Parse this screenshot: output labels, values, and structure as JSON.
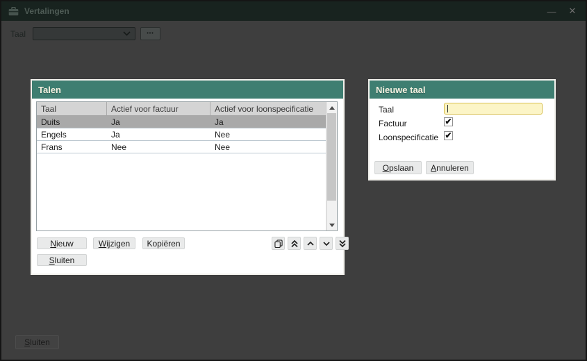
{
  "window": {
    "title": "Vertalingen"
  },
  "icons": {
    "minimize": "—",
    "close": "✕",
    "ellipsis": "•••",
    "check": "✔"
  },
  "toolbar": {
    "taal_label": "Taal",
    "taal_value": ""
  },
  "talen": {
    "title": "Talen",
    "columns": [
      "Taal",
      "Actief voor factuur",
      "Actief voor loonspecificatie"
    ],
    "rows": [
      {
        "taal": "Duits",
        "factuur": "Ja",
        "loon": "Ja"
      },
      {
        "taal": "Engels",
        "factuur": "Ja",
        "loon": "Nee"
      },
      {
        "taal": "Frans",
        "factuur": "Nee",
        "loon": "Nee"
      }
    ],
    "selected_row": "Duits",
    "buttons": {
      "nieuw": {
        "ak": "N",
        "rest": "ieuw"
      },
      "wijzigen": {
        "ak": "W",
        "rest": "ijzigen"
      },
      "kopieren": {
        "label": "Kopiëren"
      },
      "sluiten": {
        "ak": "S",
        "rest": "luiten"
      }
    }
  },
  "nieuwe_taal": {
    "title": "Nieuwe taal",
    "taal_label": "Taal",
    "taal_value": "",
    "factuur_label": "Factuur",
    "factuur_checked": true,
    "loon_label": "Loonspecificatie",
    "loon_checked": true,
    "buttons": {
      "opslaan": {
        "ak": "O",
        "rest": "pslaan"
      },
      "annuleren": {
        "ak": "A",
        "rest": "nnuleren"
      }
    }
  },
  "footer": {
    "sluiten": {
      "ak": "S",
      "rest": "luiten"
    }
  },
  "colors": {
    "titlebar": "#18231F",
    "backdrop": "#3E3E3E",
    "panel_header_teal": "#3E7E71",
    "selected_row": "#A9A9A9",
    "input_highlight_bg": "#FCF5C7",
    "input_highlight_border": "#D8BF4F"
  }
}
